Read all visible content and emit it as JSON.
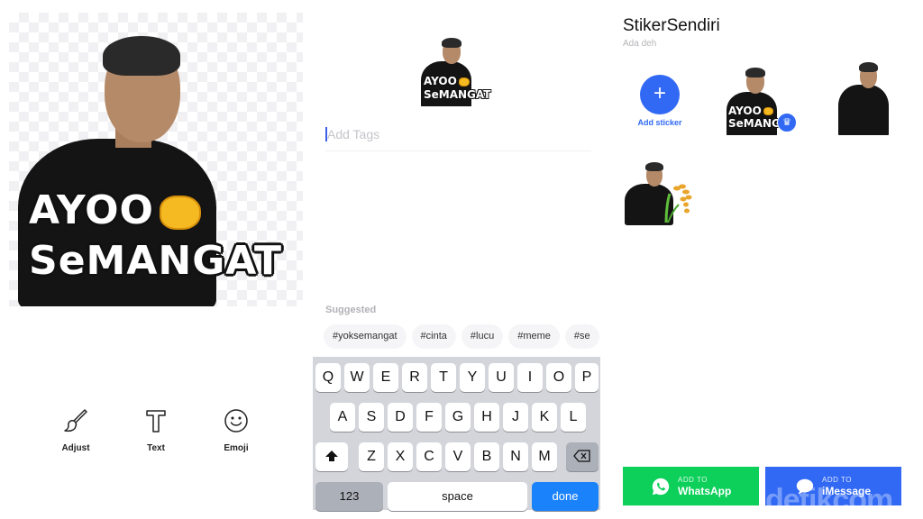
{
  "editor": {
    "sticker_text_line1": "AYOO",
    "sticker_text_line2": "SeMANGAT",
    "tools": [
      {
        "icon": "brush-icon",
        "label": "Adjust"
      },
      {
        "icon": "text-icon",
        "label": "Text"
      },
      {
        "icon": "emoji-icon",
        "label": "Emoji"
      }
    ]
  },
  "tags": {
    "thumb_line1": "AYOO",
    "thumb_line2": "SeMANGAT",
    "input_placeholder": "Add Tags",
    "input_value": "",
    "suggested_label": "Suggested",
    "chips": [
      "#yoksemangat",
      "#cinta",
      "#lucu",
      "#meme",
      "#se"
    ]
  },
  "keyboard": {
    "row1": [
      "Q",
      "W",
      "E",
      "R",
      "T",
      "Y",
      "U",
      "I",
      "O",
      "P"
    ],
    "row2": [
      "A",
      "S",
      "D",
      "F",
      "G",
      "H",
      "J",
      "K",
      "L"
    ],
    "row3": [
      "Z",
      "X",
      "C",
      "V",
      "B",
      "N",
      "M"
    ],
    "numbers_key": "123",
    "space_key": "space",
    "done_key": "done"
  },
  "pack": {
    "title": "StikerSendiri",
    "subtitle": "Ada deh",
    "add_sticker_label": "Add sticker",
    "sticker1_line1": "AYOO",
    "sticker1_line2": "SeMANG",
    "buttons": {
      "whatsapp_small": "ADD TO",
      "whatsapp_big": "WhatsApp",
      "imessage_small": "ADD TO",
      "imessage_big": "iMessage"
    },
    "watermark": "detikcom"
  },
  "colors": {
    "accent_blue": "#3169f4",
    "whatsapp_green": "#0cd05a",
    "keyboard_done": "#1a82fb",
    "keyboard_bg": "#d3d5db"
  }
}
